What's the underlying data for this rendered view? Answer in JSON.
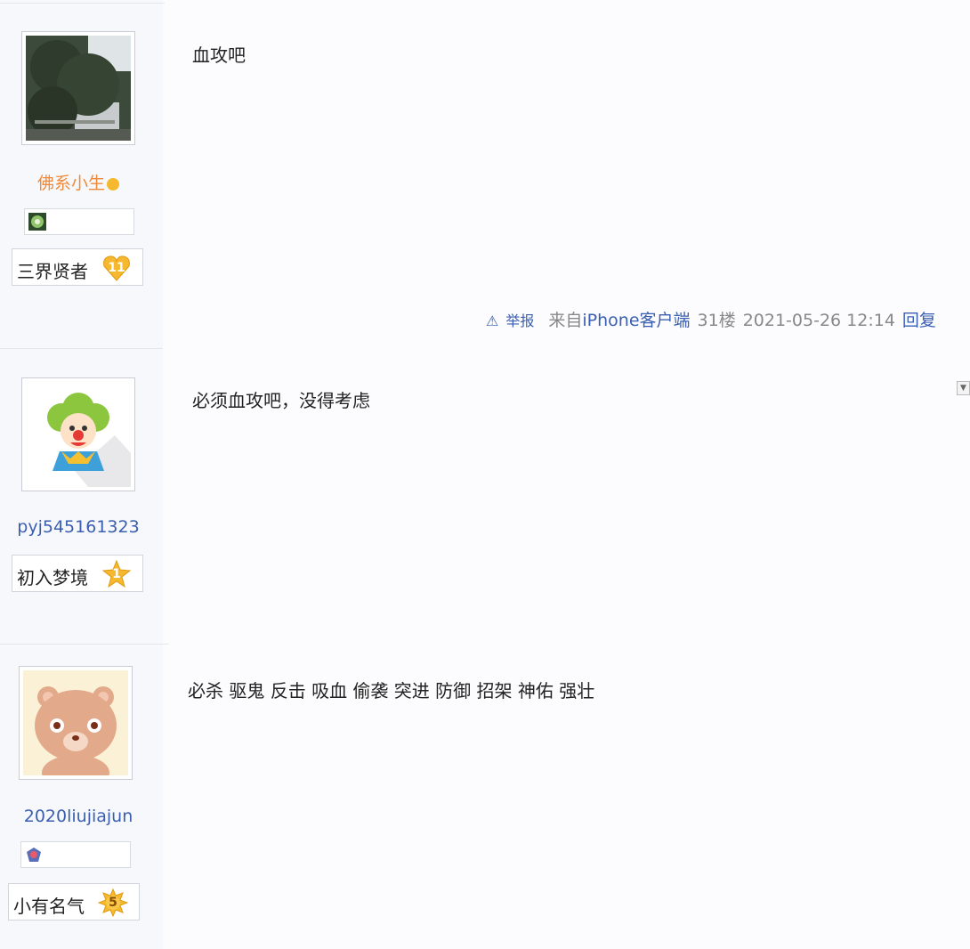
{
  "posts": [
    {
      "user": {
        "name": "佛系小生",
        "avatar_icon": "tree-photo-avatar",
        "has_badge_box": true,
        "badge_icon": "green-circle-badge-icon",
        "level_title": "三界贤者",
        "level_number": "11",
        "level_icon": "gold-heart-level-icon"
      },
      "content": "血攻吧",
      "meta": {
        "report_label": "举报",
        "source_prefix": "来自",
        "source_client": "iPhone客户端",
        "floor": "31楼",
        "datetime": "2021-05-26 12:14",
        "reply_label": "回复"
      }
    },
    {
      "user": {
        "name": "pyj545161323",
        "avatar_icon": "clown-avatar",
        "has_badge_box": false,
        "level_title": "初入梦境",
        "level_number": "1",
        "level_icon": "gold-star-level-icon"
      },
      "content": "必须血攻吧，没得考虑"
    },
    {
      "user": {
        "name": "2020liujiajun",
        "avatar_icon": "bear-avatar",
        "has_badge_box": true,
        "badge_icon": "blue-crest-badge-icon",
        "level_title": "小有名气",
        "level_number": "5",
        "level_icon": "gold-burst-level-icon"
      },
      "content": "必杀 驱鬼 反击 吸血 偷袭 突进 防御 招架 神佑 强壮"
    }
  ],
  "colors": {
    "username_link": "#3a5fb0",
    "username_vip": "#f08a3a",
    "level_gold": "#f5b82e"
  }
}
